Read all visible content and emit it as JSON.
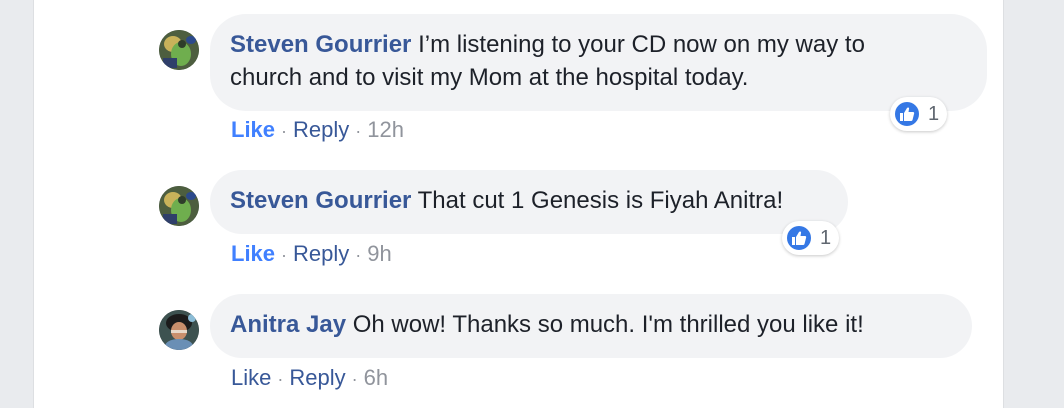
{
  "comments": [
    {
      "author": "Steven Gourrier",
      "text_line1": "I’m listening to your CD now on my way to",
      "text_line2": "church and to visit my Mom at the hospital today.",
      "like_label": "Like",
      "reply_label": "Reply",
      "separator": "·",
      "timestamp": "12h",
      "reaction_count": "1",
      "reaction_icon": "thumbs-up-icon",
      "liked": true
    },
    {
      "author": "Steven Gourrier",
      "text_line1": "That cut 1 Genesis is Fiyah Anitra!",
      "like_label": "Like",
      "reply_label": "Reply",
      "separator": "·",
      "timestamp": "9h",
      "reaction_count": "1",
      "reaction_icon": "thumbs-up-icon",
      "liked": true
    },
    {
      "author": "Anitra Jay",
      "text_line1": "Oh wow! Thanks so much. I'm thrilled you like it!",
      "like_label": "Like",
      "reply_label": "Reply",
      "separator": "·",
      "timestamp": "6h",
      "liked": false
    }
  ],
  "colors": {
    "author": "#385898",
    "like_active": "#4080ff",
    "bubble_bg": "#f2f3f5",
    "reaction_blue": "#3578e5",
    "page_bg": "#e9ebee"
  }
}
